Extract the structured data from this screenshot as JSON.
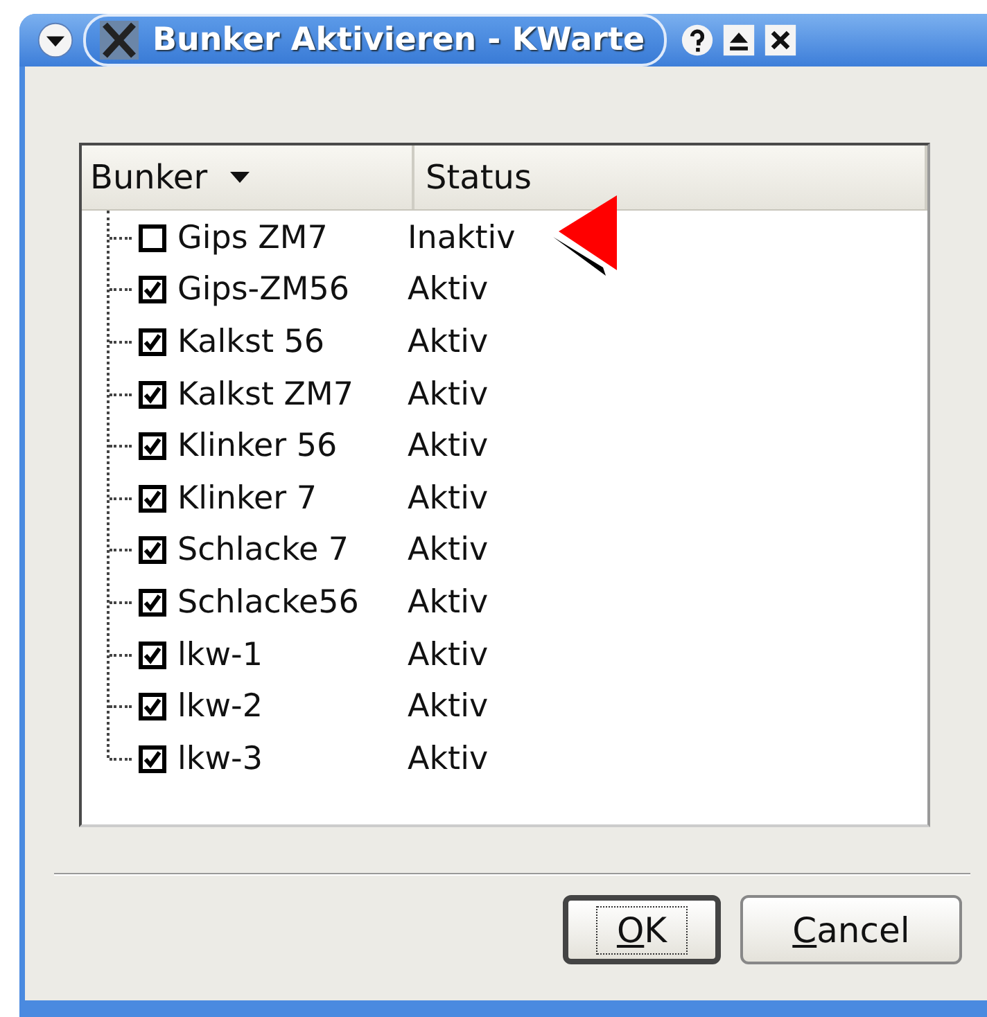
{
  "window": {
    "title": "Bunker Aktivieren - KWarte"
  },
  "table": {
    "columns": [
      {
        "label": "Bunker",
        "sorted": true
      },
      {
        "label": "Status",
        "sorted": false
      }
    ],
    "rows": [
      {
        "name": "Gips ZM7",
        "checked": false,
        "status": "Inaktiv",
        "flagged": true
      },
      {
        "name": "Gips-ZM56",
        "checked": true,
        "status": "Aktiv",
        "flagged": false
      },
      {
        "name": "Kalkst 56",
        "checked": true,
        "status": "Aktiv",
        "flagged": false
      },
      {
        "name": "Kalkst ZM7",
        "checked": true,
        "status": "Aktiv",
        "flagged": false
      },
      {
        "name": "Klinker 56",
        "checked": true,
        "status": "Aktiv",
        "flagged": false
      },
      {
        "name": "Klinker 7",
        "checked": true,
        "status": "Aktiv",
        "flagged": false
      },
      {
        "name": "Schlacke 7",
        "checked": true,
        "status": "Aktiv",
        "flagged": false
      },
      {
        "name": "Schlacke56",
        "checked": true,
        "status": "Aktiv",
        "flagged": false
      },
      {
        "name": "lkw-1",
        "checked": true,
        "status": "Aktiv",
        "flagged": false
      },
      {
        "name": "lkw-2",
        "checked": true,
        "status": "Aktiv",
        "flagged": false
      },
      {
        "name": "lkw-3",
        "checked": true,
        "status": "Aktiv",
        "flagged": false
      }
    ]
  },
  "buttons": [
    {
      "accel": "O",
      "rest": "K",
      "default": true
    },
    {
      "accel": "C",
      "rest": "ancel",
      "default": false
    }
  ]
}
